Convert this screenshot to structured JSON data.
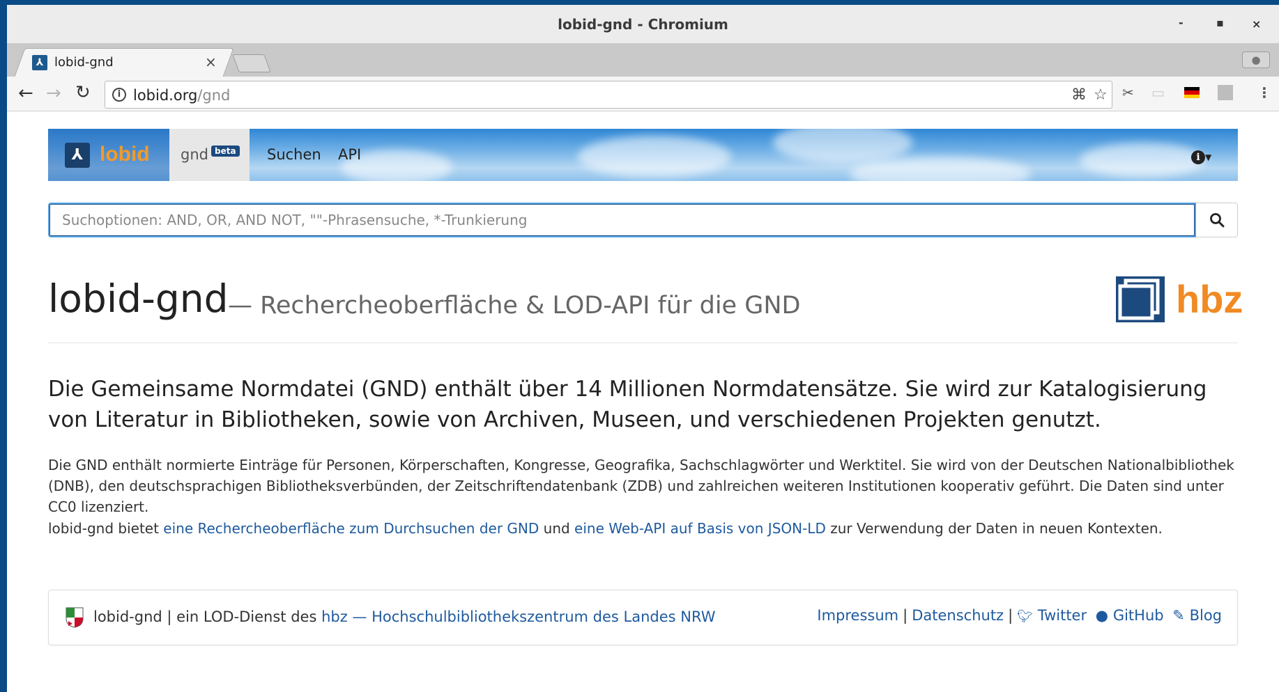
{
  "window": {
    "title": "lobid-gnd - Chromium",
    "controls": {
      "minimize": "-",
      "maximize": "▪",
      "close": "×"
    }
  },
  "tab": {
    "title": "lobid-gnd",
    "close": "×"
  },
  "omnibox": {
    "host": "lobid.org",
    "path": "/gnd"
  },
  "navbar": {
    "brand": "lobid",
    "gnd_label": "gnd",
    "beta": "beta",
    "links": [
      "Suchen",
      "API"
    ],
    "info_icon": "i"
  },
  "search": {
    "placeholder": "Suchoptionen: AND, OR, AND NOT, \"\"-Phrasensuche, *-Trunkierung"
  },
  "hero": {
    "title": "lobid-gnd",
    "subtitle": "— Rechercheoberfläche & LOD-API für die GND",
    "logo_text": "hbz"
  },
  "lead": "Die Gemeinsame Normdatei (GND) enthält über 14 Millionen Normdatensätze. Sie wird zur Katalogisierung von Literatur in Bibliotheken, sowie von Archiven, Museen, und verschiedenen Projekten genutzt.",
  "paragraph1": "Die GND enthält normierte Einträge für Personen, Körperschaften, Kongresse, Geografika, Sachschlagwörter und Werktitel. Sie wird von der Deutschen Nationalbibliothek (DNB), den deutschsprachigen Bibliotheksverbünden, der Zeitschriftendatenbank (ZDB) und zahlreichen weiteren Institutionen kooperativ geführt. Die Daten sind unter CC0 lizenziert.",
  "paragraph2": {
    "prefix": "lobid-gnd bietet ",
    "link1": "eine Rechercheoberfläche zum Durchsuchen der GND",
    "middle": " und ",
    "link2": "eine Web-API auf Basis von JSON-LD",
    "suffix": " zur Verwendung der Daten in neuen Kontexten."
  },
  "footer": {
    "prefix": "lobid-gnd | ein LOD-Dienst des ",
    "hbz_link": "hbz — Hochschulbibliothekszentrum des Landes NRW",
    "impressum": "Impressum",
    "datenschutz": "Datenschutz",
    "twitter": "Twitter",
    "github": "GitHub",
    "blog": "Blog",
    "separator": "|"
  },
  "colors": {
    "brand_orange": "#f39a29",
    "link_blue": "#1e5a9e",
    "badge_navy": "#1c4a7e"
  }
}
